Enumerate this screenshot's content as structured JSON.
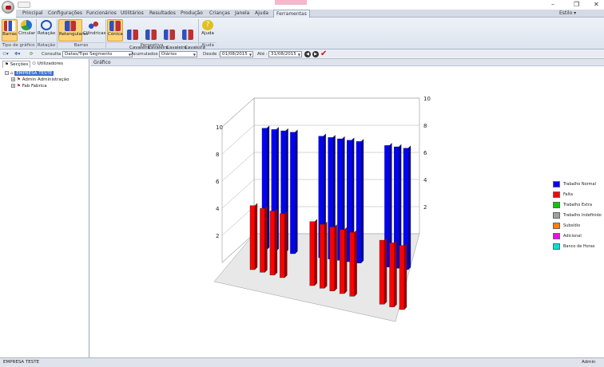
{
  "window": {
    "minimize": "–",
    "maximize": "❐",
    "close": "✕"
  },
  "tabs": [
    "Principal",
    "Configurações",
    "Funcionários",
    "Utilitários",
    "Resultados",
    "Produção",
    "Crianças",
    "Janela",
    "Ajuda",
    "Ferramentas"
  ],
  "active_tab": "Ferramentas",
  "user_label": "Estilo ▾",
  "ribbon": {
    "buttons": {
      "barras": "Barras",
      "circular": "Circular",
      "rotacao": "Rotação",
      "retangulares": "Retangulares",
      "cilindricas": "Cilíndricas",
      "conica": "Cónica",
      "cav1": "Cavaleira\n1",
      "cav2": "Cavaleira\n2",
      "cav3": "Cavaleira\n3",
      "cav4": "Cavaleira\n4",
      "ajuda": "Ajuda"
    },
    "groups": {
      "tipo": "Tipo de gráfico",
      "rotacao": "Rotação",
      "barras": "Barras",
      "perspetiva": "Perspetiva",
      "ajuda": "Ajuda"
    }
  },
  "toolbar": {
    "consulta_label": "Consulta :",
    "consulta_value": "Datas/Tipo Segmento",
    "acumulados_label": "Acumulados :",
    "acumulados_value": "Diários",
    "desde_label": "Desde :",
    "desde_value": "01/08/2015",
    "ate_label": "Até :",
    "ate_value": "31/08/2015"
  },
  "left_panel": {
    "tabs": [
      "Secções",
      "Utilizadores"
    ],
    "tree": {
      "root": "EMPRESA TESTE",
      "children": [
        "Admin Administração",
        "Fab Fabrica"
      ]
    }
  },
  "main": {
    "title": "Gráfico"
  },
  "chart_data": {
    "type": "bar",
    "ylim": [
      0,
      10
    ],
    "yticks": [
      "10",
      "8",
      "6",
      "4",
      "2"
    ],
    "series": [
      {
        "name": "Trabalho Normal",
        "color": "#0000ff",
        "values": [
          8,
          8,
          8,
          8,
          0,
          0,
          8,
          8,
          8,
          8,
          8,
          0,
          0,
          8,
          8,
          8
        ]
      },
      {
        "name": "Falta",
        "color": "#ff0000",
        "values": [
          4,
          4,
          4,
          4,
          0,
          0,
          4,
          4,
          4,
          4,
          4,
          0,
          0,
          4,
          4,
          4
        ]
      },
      {
        "name": "Trabalho Extra",
        "color": "#00cc00",
        "values": [
          0,
          0,
          0,
          0,
          0,
          0,
          0,
          0,
          0,
          0,
          0,
          0,
          0,
          0,
          0,
          0
        ]
      },
      {
        "name": "Trabalho Indefinido",
        "color": "#a0a0a0",
        "values": [
          0,
          0,
          0,
          0,
          0,
          0,
          0,
          0,
          0,
          0,
          0,
          0,
          0,
          0,
          0,
          0
        ]
      },
      {
        "name": "Subsídio",
        "color": "#ff8000",
        "values": [
          0,
          0,
          0,
          0,
          0,
          0,
          0,
          0,
          0,
          0,
          0,
          0,
          0,
          0,
          0,
          0
        ]
      },
      {
        "name": "Adicional",
        "color": "#ff00ff",
        "values": [
          0,
          0,
          0,
          0,
          0,
          0,
          0,
          0,
          0,
          0,
          0,
          0,
          0,
          0,
          0,
          0
        ]
      },
      {
        "name": "Banco de Horas",
        "color": "#00e0e0",
        "values": [
          0,
          0,
          0,
          0,
          0,
          0,
          0,
          0,
          0,
          0,
          0,
          0,
          0,
          0,
          0,
          0
        ]
      }
    ]
  },
  "status": {
    "left": "EMPRESA TESTE",
    "right": "Admin"
  }
}
